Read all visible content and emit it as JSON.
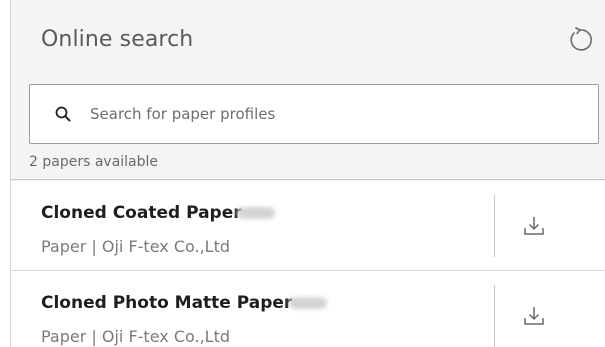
{
  "header": {
    "title": "Online search",
    "refresh_icon": "refresh-icon"
  },
  "search": {
    "placeholder": "Search for paper profiles",
    "value": "",
    "icon": "search-icon"
  },
  "results": {
    "count_text": "2 papers available",
    "items": [
      {
        "name": "Cloned Coated Paper",
        "meta": "Paper |  Oji F-tex Co.,Ltd",
        "action_icon": "download-icon"
      },
      {
        "name": "Cloned Photo Matte Paper",
        "meta": "Paper |  Oji F-tex Co.,Ltd",
        "action_icon": "download-icon"
      }
    ]
  },
  "colors": {
    "background": "#f4f4f4",
    "panel": "#ffffff",
    "text_primary": "#1e1e1e",
    "text_secondary": "#7a7a7a"
  }
}
